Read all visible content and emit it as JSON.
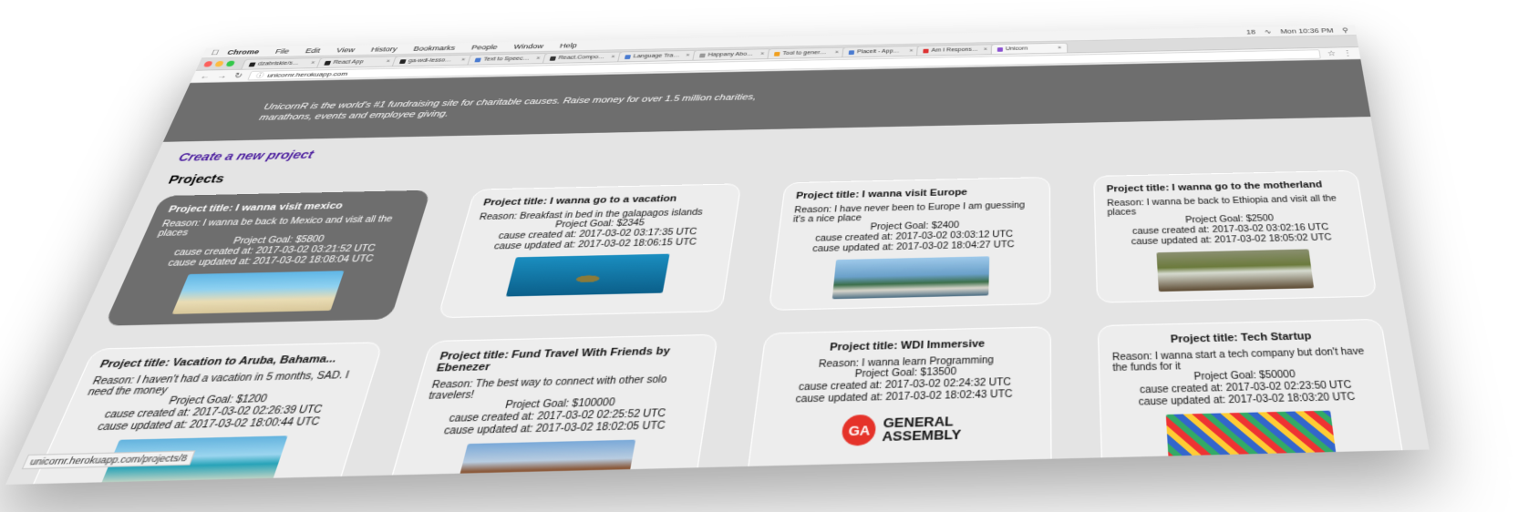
{
  "mac_menubar": {
    "items": [
      "Chrome",
      "File",
      "Edit",
      "View",
      "History",
      "Bookmarks",
      "People",
      "Window",
      "Help"
    ],
    "right": [
      "18",
      "Mon 10:36 PM"
    ]
  },
  "tabs": [
    {
      "label": "dzabriskie/s…"
    },
    {
      "label": "React App"
    },
    {
      "label": "ga-wdi-lesso…"
    },
    {
      "label": "Text to Speec…"
    },
    {
      "label": "React.Compo…"
    },
    {
      "label": "Language Tra…"
    },
    {
      "label": "Happany Abo…"
    },
    {
      "label": "Tool to gener…"
    },
    {
      "label": "Placeit - App…"
    },
    {
      "label": "Am I Respons…"
    },
    {
      "label": "Unicorn"
    }
  ],
  "address": {
    "url": "unicornr.herokuapp.com"
  },
  "hero": {
    "text": "UnicornR is the world's #1 fundraising site for charitable causes. Raise money for over 1.5 million charities, marathons, events and employee giving."
  },
  "create_link": "Create a new project",
  "projects_heading": "Projects",
  "projects": [
    {
      "title": "Project title: I wanna visit mexico",
      "reason": "Reason: I wanna be back to Mexico and visit all the places",
      "goal": "Project Goal: $5800",
      "created": "cause created at: 2017-03-02 03:21:52 UTC",
      "updated": "cause updated at: 2017-03-02 18:08:04 UTC",
      "image": "beach"
    },
    {
      "title": "Project title: I wanna go to a vacation",
      "reason": "Reason: Breakfast in bed in the galapagos islands",
      "goal": "Project Goal: $2345",
      "created": "cause created at: 2017-03-02 03:17:35 UTC",
      "updated": "cause updated at: 2017-03-02 18:06:15 UTC",
      "image": "turtle"
    },
    {
      "title": "Project title: I wanna visit Europe",
      "reason": "Reason: I have never been to Europe I am guessing it's a nice place",
      "goal": "Project Goal: $2400",
      "created": "cause created at: 2017-03-02 03:03:12 UTC",
      "updated": "cause updated at: 2017-03-02 18:04:27 UTC",
      "image": "europe"
    },
    {
      "title": "Project title: I wanna go to the motherland",
      "reason": "Reason: I wanna be back to Ethiopia and visit all the places",
      "goal": "Project Goal: $2500",
      "created": "cause created at: 2017-03-02 03:02:16 UTC",
      "updated": "cause updated at: 2017-03-02 18:05:02 UTC",
      "image": "falls"
    },
    {
      "title": "Project title: Vacation to Aruba, Bahama...",
      "reason": "Reason: I haven't had a vacation in 5 months, SAD. I need the money",
      "goal": "Project Goal: $1200",
      "created": "cause created at: 2017-03-02 02:26:39 UTC",
      "updated": "cause updated at: 2017-03-02 18:00:44 UTC",
      "image": "aruba"
    },
    {
      "title": "Project title: Fund Travel With Friends by Ebenezer",
      "reason": "Reason: The best way to connect with other solo travelers!",
      "goal": "Project Goal: $100000",
      "created": "cause created at: 2017-03-02 02:25:52 UTC",
      "updated": "cause updated at: 2017-03-02 18:02:05 UTC",
      "image": "friends"
    },
    {
      "title": "Project title: WDI Immersive",
      "reason": "Reason: I wanna learn Programming",
      "goal": "Project Goal: $13500",
      "created": "cause created at: 2017-03-02 02:24:32 UTC",
      "updated": "cause updated at: 2017-03-02 18:02:43 UTC",
      "image": "ga"
    },
    {
      "title": "Project title: Tech Startup",
      "reason": "Reason: I wanna start a tech company but don't have the funds for it",
      "goal": "Project Goal: $50000",
      "created": "cause created at: 2017-03-02 02:23:50 UTC",
      "updated": "cause updated at: 2017-03-02 18:03:20 UTC",
      "image": "startup"
    }
  ],
  "ga_logo": {
    "mark": "GA",
    "line1": "GENERAL",
    "line2": "ASSEMBLY"
  },
  "statusbar": "unicornr.herokuapp.com/projects/8"
}
